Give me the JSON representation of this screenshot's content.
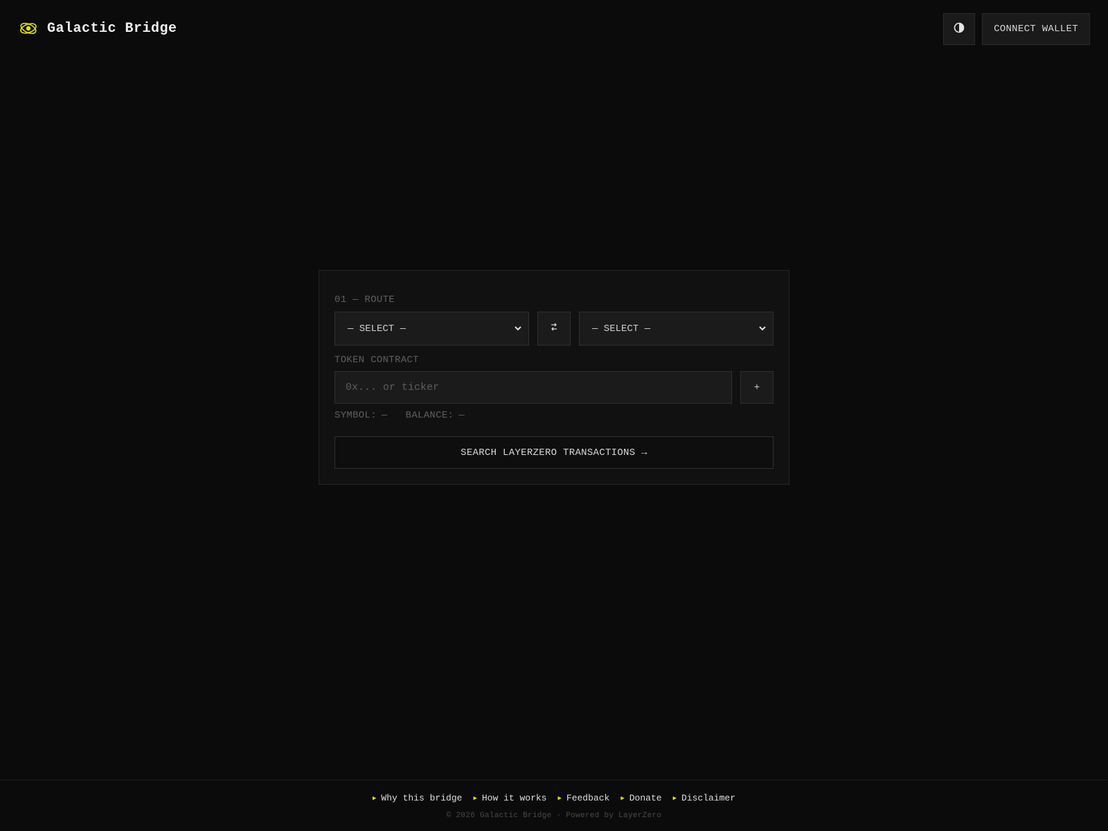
{
  "app": {
    "title": "Galactic Bridge",
    "logo_icon": "planet-orbit-icon",
    "accent_color": "#e3e600"
  },
  "header": {
    "theme_toggle_icon": "half-moon-contrast-icon",
    "connect_wallet_label": "CONNECT WALLET"
  },
  "route": {
    "section_label": "01 — ROUTE",
    "from_select_value": "— SELECT —",
    "to_select_value": "— SELECT —",
    "swap_icon": "swap-arrows-icon",
    "swap_glyph": "⇄"
  },
  "token": {
    "section_label": "TOKEN CONTRACT",
    "input_placeholder": "0x... or ticker",
    "input_value": "",
    "add_label": "+",
    "symbol_label": "SYMBOL:",
    "symbol_value": "—",
    "balance_label": "BALANCE:",
    "balance_value": "—"
  },
  "search_button_label": "SEARCH LAYERZERO TRANSACTIONS →",
  "footer": {
    "links": [
      {
        "label": "Why this bridge"
      },
      {
        "label": "How it works"
      },
      {
        "label": "Feedback"
      },
      {
        "label": "Donate"
      },
      {
        "label": "Disclaimer"
      }
    ],
    "copyright": "© 2026 Galactic Bridge · Powered by LayerZero"
  }
}
